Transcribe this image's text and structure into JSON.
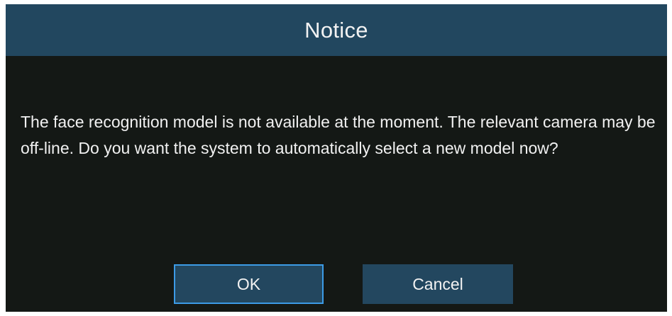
{
  "dialog": {
    "title": "Notice",
    "message": "The face recognition model is not available at the moment. The relevant camera may be off-line. Do you want the system to automatically select a new model now?",
    "buttons": {
      "ok_label": "OK",
      "cancel_label": "Cancel"
    },
    "focused_button": "OK"
  },
  "colors": {
    "titlebar": "#22475f",
    "body_background": "#141815",
    "button_background": "#23475f",
    "focus_border": "#3c9be6",
    "text": "#f1f1f1"
  }
}
